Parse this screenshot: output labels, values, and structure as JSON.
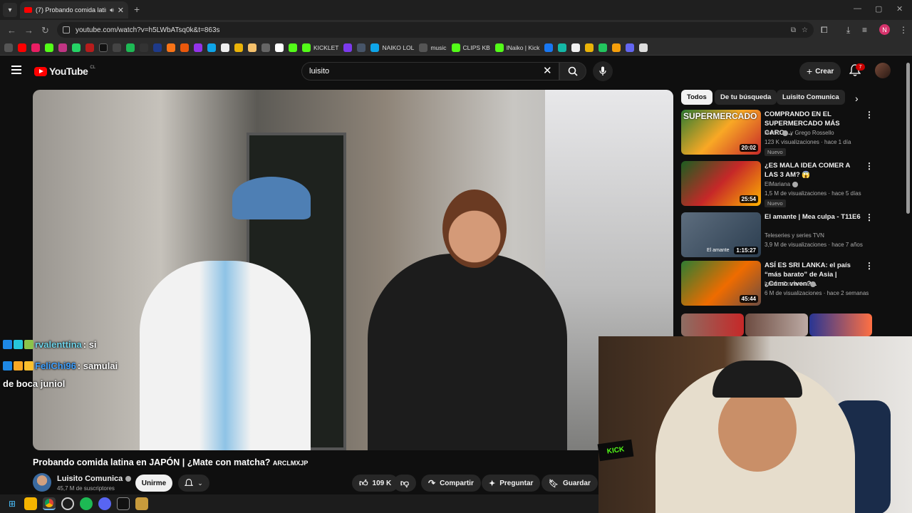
{
  "browser": {
    "tab_title": "(7) Probando comida latina",
    "url": "youtube.com/watch?v=h5LWbATsq0k&t=863s",
    "profile_initial": "N",
    "bookmarks": [
      "KICKLET",
      "NAIKO LOL",
      "music",
      "CLIPS KB",
      "lNaiko | Kick"
    ]
  },
  "header": {
    "logo_text": "YouTube",
    "country_code": "CL",
    "search_value": "luisito",
    "create_label": "Crear",
    "notifications_count": "7"
  },
  "video": {
    "title": "Probando comida latina en JAPÓN | ¿Mate con matcha?",
    "title_suffix": "ARCLMXJP",
    "channel": "Luisito Comunica",
    "subscribers": "45,7 M de suscriptores",
    "join_label": "Unirme",
    "likes": "109 K",
    "share_label": "Compartir",
    "ask_label": "Preguntar",
    "save_label": "Guardar"
  },
  "chat_overlay": [
    {
      "user": "rvalenttina",
      "message": ": si"
    },
    {
      "user": "FeliChi96",
      "message": ": samulai"
    },
    {
      "user": "",
      "message": "de boca juniol"
    }
  ],
  "chips": [
    "Todos",
    "De tu búsqueda",
    "Luisito Comunica"
  ],
  "recommendations": [
    {
      "title": "COMPRANDO EN EL SUPERMERCADO MÁS CARO ...",
      "channel": "Momo",
      "channel_suffix": "y Grego Rossello",
      "meta": "123 K visualizaciones · hace 1 día",
      "badge": "Nuevo",
      "duration": "20:02",
      "thumb_text": "SUPERMERCADO"
    },
    {
      "title": "¿ES MALA IDEA COMER A LAS 3 AM? 😱",
      "channel": "ElMariana",
      "channel_suffix": "",
      "meta": "1,5 M de visualizaciones · hace 5 días",
      "badge": "Nuevo",
      "duration": "25:54",
      "thumb_text": ""
    },
    {
      "title": "El amante | Mea culpa - T11E6",
      "channel": "Teleseries y series TVN",
      "channel_suffix": "",
      "meta": "3,9 M de visualizaciones · hace 7 años",
      "badge": "",
      "duration": "1:15:27",
      "thumb_text": "El amante"
    },
    {
      "title": "ASÍ ES SRI LANKA: el país “más barato” de Asia | ¿Cómo viven?...",
      "channel": "Luisito Comunica",
      "channel_suffix": "",
      "meta": "6 M de visualizaciones · hace 2 semanas",
      "badge": "",
      "duration": "45:44",
      "thumb_text": ""
    }
  ],
  "webcam": {
    "overlay_text": "KICK"
  },
  "colors": {
    "accent": "#ff0000",
    "bg": "#0f0f0f",
    "chip_active": "#f1f1f1"
  }
}
